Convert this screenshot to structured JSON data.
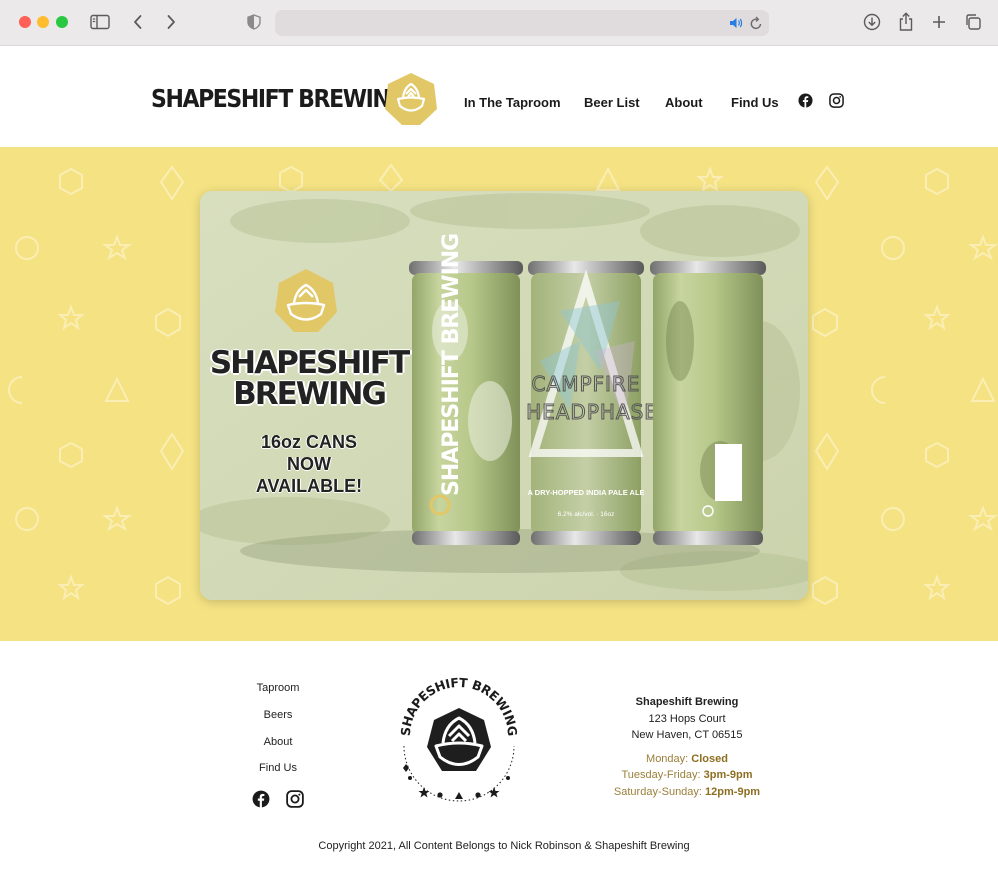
{
  "colors": {
    "hero_bg": "#f4e283",
    "logo_gold": "#e2c766",
    "hours_text": "#9a7f3a",
    "can_green": "#b9c98d"
  },
  "header": {
    "brand": "SHAPESHIFT BREWING",
    "nav": [
      "In The Taproom",
      "Beer List",
      "About",
      "Find Us"
    ],
    "social_icons": [
      "facebook-icon",
      "instagram-icon"
    ]
  },
  "hero": {
    "banner_title_line1": "SHAPESHIFT",
    "banner_title_line2": "BREWING",
    "banner_sub_line1": "16oz CANS",
    "banner_sub_line2": "NOW",
    "banner_sub_line3": "AVAILABLE!",
    "can_brand": "SHAPESHIFT BREWING",
    "can_name_line1": "CAMPFIRE",
    "can_name_line2": "HEADPHASE",
    "can_style": "A DRY-HOPPED INDIA PALE ALE",
    "can_abv": "6.2% alc/vol. · 16oz"
  },
  "footer": {
    "links": [
      "Taproom",
      "Beers",
      "About",
      "Find Us"
    ],
    "badge_text": "SHAPESHIFT BREWING",
    "address_name": "Shapeshift Brewing",
    "address_line1": "123 Hops Court",
    "address_line2": "New Haven, CT 06515",
    "hours": [
      {
        "days": "Monday: ",
        "time": "Closed"
      },
      {
        "days": "Tuesday-Friday: ",
        "time": "3pm-9pm"
      },
      {
        "days": "Saturday-Sunday: ",
        "time": "12pm-9pm"
      }
    ],
    "copyright": "Copyright 2021, All Content Belongs to Nick Robinson & Shapeshift Brewing"
  }
}
